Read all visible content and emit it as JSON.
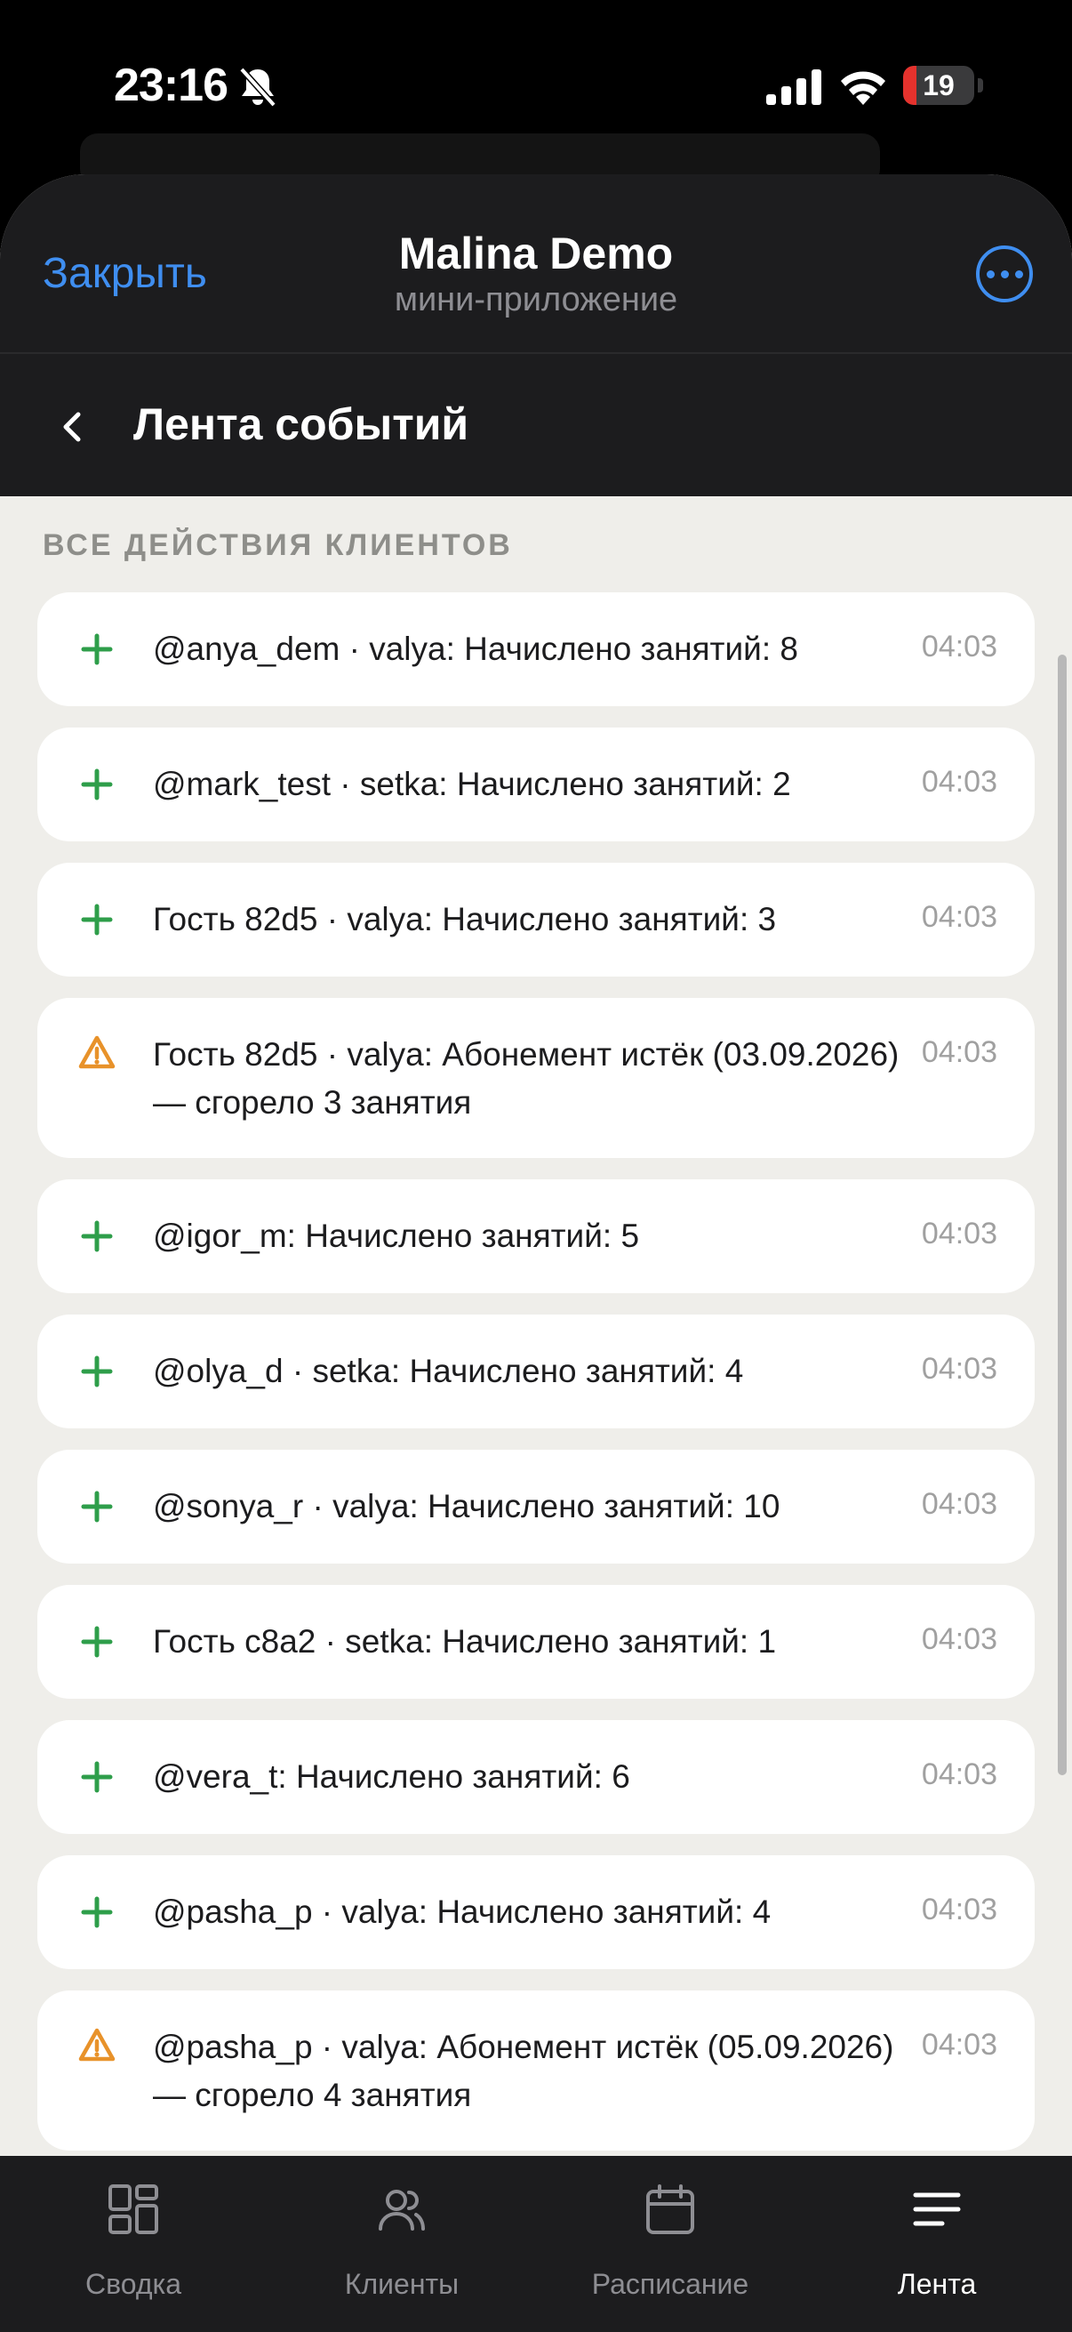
{
  "status_bar": {
    "time": "23:16",
    "battery": "19",
    "battery_level": 0.19
  },
  "header": {
    "close_label": "Закрыть",
    "title": "Malina Demo",
    "subtitle": "мини-приложение"
  },
  "nav": {
    "title": "Лента событий"
  },
  "section": {
    "header": "ВСЕ ДЕЙСТВИЯ КЛИЕНТОВ"
  },
  "colors": {
    "accent": "#3f8ef0",
    "credit": "#2e9e4a",
    "warning": "#e8922a"
  },
  "events": [
    {
      "type": "credit",
      "icon": "plus-icon",
      "text": "@anya_dem · valya: Начислено занятий: 8",
      "time": "04:03"
    },
    {
      "type": "credit",
      "icon": "plus-icon",
      "text": "@mark_test · setka: Начислено занятий: 2",
      "time": "04:03"
    },
    {
      "type": "credit",
      "icon": "plus-icon",
      "text": "Гость 82d5 · valya: Начислено занятий: 3",
      "time": "04:03"
    },
    {
      "type": "warning",
      "icon": "warning-icon",
      "text": "Гость 82d5 · valya: Абонемент истёк (03.09.2026) — сгорело 3 занятия",
      "time": "04:03"
    },
    {
      "type": "credit",
      "icon": "plus-icon",
      "text": "@igor_m: Начислено занятий: 5",
      "time": "04:03"
    },
    {
      "type": "credit",
      "icon": "plus-icon",
      "text": "@olya_d · setka: Начислено занятий: 4",
      "time": "04:03"
    },
    {
      "type": "credit",
      "icon": "plus-icon",
      "text": "@sonya_r · valya: Начислено занятий: 10",
      "time": "04:03"
    },
    {
      "type": "credit",
      "icon": "plus-icon",
      "text": "Гость c8a2 · setka: Начислено занятий: 1",
      "time": "04:03"
    },
    {
      "type": "credit",
      "icon": "plus-icon",
      "text": "@vera_t: Начислено занятий: 6",
      "time": "04:03"
    },
    {
      "type": "credit",
      "icon": "plus-icon",
      "text": "@pasha_p · valya: Начислено занятий: 4",
      "time": "04:03"
    },
    {
      "type": "warning",
      "icon": "warning-icon",
      "text": "@pasha_p · valya: Абонемент истёк (05.09.2026) — сгорело 4 занятия",
      "time": "04:03"
    }
  ],
  "tabs": [
    {
      "label": "Сводка",
      "icon": "dashboard-icon",
      "active": false
    },
    {
      "label": "Клиенты",
      "icon": "users-icon",
      "active": false
    },
    {
      "label": "Расписание",
      "icon": "calendar-icon",
      "active": false
    },
    {
      "label": "Лента",
      "icon": "feed-icon",
      "active": true
    }
  ]
}
